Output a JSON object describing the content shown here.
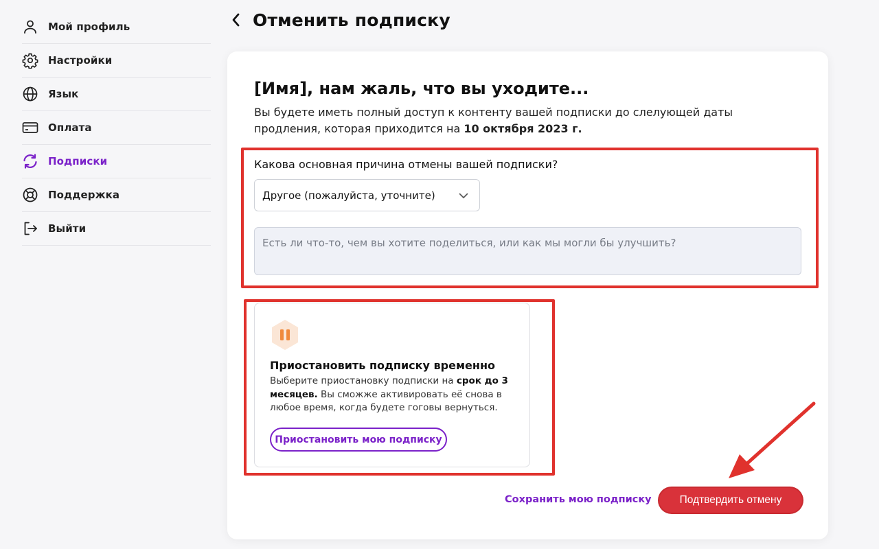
{
  "sidebar": {
    "items": [
      {
        "label": "Мой профиль",
        "icon": "user-icon",
        "active": false
      },
      {
        "label": "Настройки",
        "icon": "gear-icon",
        "active": false
      },
      {
        "label": "Язык",
        "icon": "globe-icon",
        "active": false
      },
      {
        "label": "Оплата",
        "icon": "credit-card-icon",
        "active": false
      },
      {
        "label": "Подписки",
        "icon": "refresh-icon",
        "active": true
      },
      {
        "label": "Поддержка",
        "icon": "lifebuoy-icon",
        "active": false
      },
      {
        "label": "Выйти",
        "icon": "logout-icon",
        "active": false
      }
    ]
  },
  "header": {
    "back_icon": "chevron-left-icon",
    "title": "Отменить подписку"
  },
  "card": {
    "heading": "[Имя], нам жаль, что вы уходите...",
    "description_start": "Вы будете иметь полный доступ к контенту вашей подписки до слелующей даты продления, которая приходится на ",
    "description_date": "10 октября 2023 г.",
    "reason_question": "Какова основная причина отмены вашей подписки?",
    "reason_select_value": "Другое (пожалуйста, уточните)",
    "feedback_placeholder": "Есть ли что-то, чем вы хотите поделиться, или как мы могли бы улучшить?",
    "pause": {
      "icon": "pause-icon",
      "title": "Приостановить подписку временно",
      "desc_1": "Выберите приостановку подписки на ",
      "desc_bold_1": "срок до 3 месяцев.",
      "desc_2": " Вы сможже активировать её снова в любое время, когда будете гоговы вернуться.",
      "button_label": "Приостановить мою подписку"
    },
    "keep_link": "Сохранить мою подписку",
    "confirm_button": "Подтвердить отмену"
  },
  "colors": {
    "accent_purple": "#7b22c9",
    "confirm_red": "#d9323a",
    "annotation_red": "#e0322d",
    "pause_orange": "#f08a3c"
  }
}
